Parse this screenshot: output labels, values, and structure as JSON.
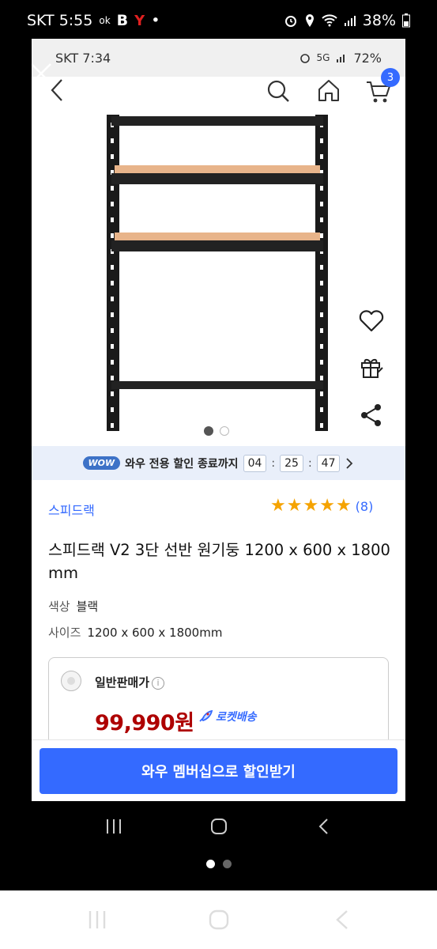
{
  "outer_status": {
    "time": "SKT 5:55",
    "net": "ok",
    "letter_b": "B",
    "battery": "38%"
  },
  "inner_status": {
    "time": "SKT 7:34",
    "net": "5G",
    "battery": "72%"
  },
  "header": {
    "cart_count": "3"
  },
  "gallery": {
    "dots": 2,
    "active": 0
  },
  "wow_bar": {
    "badge": "WOW",
    "text": "와우 전용 할인 종료까지",
    "hours": "04",
    "minutes": "25",
    "seconds": "47"
  },
  "product": {
    "brand": "스피드랙",
    "rating": 5,
    "review_count": "(8)",
    "title": "스피드랙 V2 3단 선반 원기둥 1200 x 600 x 1800 mm",
    "color_label": "색상",
    "color_value": "블랙",
    "size_label": "사이즈",
    "size_value": "1200 x 600 x 1800mm"
  },
  "price_card": {
    "seller_label": "일반판매가",
    "info_icon": "i",
    "price": "99,990원",
    "delivery": "로켓배송"
  },
  "cta": {
    "label": "와우 멤버십으로 할인받기"
  },
  "colors": {
    "accent": "#346aff",
    "price": "#ae0000",
    "star": "#f5a300",
    "wow_bg": "#e9effa"
  }
}
